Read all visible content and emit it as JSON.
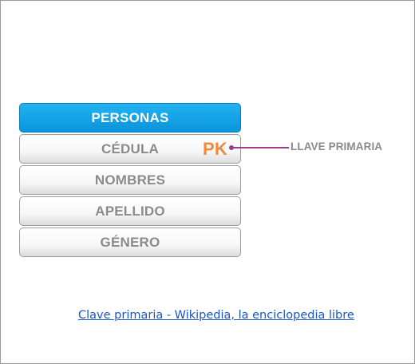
{
  "table": {
    "header": "PERSONAS",
    "rows": [
      {
        "label": "CÉDULA",
        "badge": "PK"
      },
      {
        "label": "NOMBRES"
      },
      {
        "label": "APELLIDO"
      },
      {
        "label": "GÉNERO"
      }
    ]
  },
  "annotation": {
    "label": "LLAVE PRIMARIA",
    "line_color": "#9c3a8c",
    "badge_color": "#f08a3c"
  },
  "link": {
    "text": "Clave primaria - Wikipedia, la enciclopedia libre"
  },
  "colors": {
    "header_blue": "#0a94dc",
    "row_text": "#8a8a8a",
    "link_blue": "#1a56c8"
  }
}
